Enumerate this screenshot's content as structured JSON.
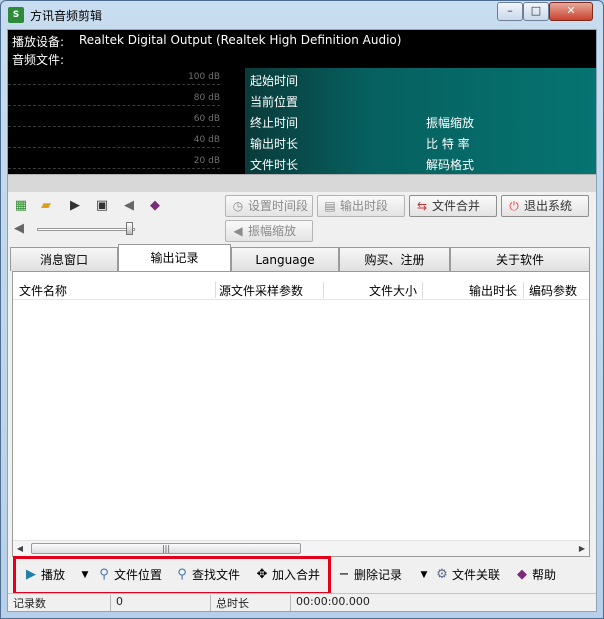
{
  "window": {
    "title": "方讯音频剪辑",
    "minimize": "–",
    "maximize": "□",
    "close": "✕"
  },
  "info": {
    "device_label": "播放设备:",
    "device_value": "Realtek Digital Output (Realtek High Definition Audio)",
    "file_label": "音频文件:"
  },
  "meter": {
    "levels": [
      "100 dB",
      "80 dB",
      "60 dB",
      "40 dB",
      "20 dB"
    ]
  },
  "time_labels": {
    "start": "起始时间",
    "current": "当前位置",
    "end": "终止时间",
    "output_duration": "输出时长",
    "file_duration": "文件时长",
    "amplitude": "振幅缩放",
    "bitrate": "比 特 率",
    "format": "解码格式"
  },
  "toolbar": {
    "set_period": "设置时间段",
    "output_period": "输出时段",
    "merge_files": "文件合并",
    "exit": "退出系统",
    "amplitude_zoom": "振幅缩放"
  },
  "volume": {
    "level": 0.95
  },
  "tabs": [
    "消息窗口",
    "输出记录",
    "Language",
    "购买、注册",
    "关于软件"
  ],
  "active_tab": 1,
  "list": {
    "columns": [
      "文件名称",
      "源文件采样参数",
      "文件大小",
      "输出时长",
      "编码参数"
    ],
    "rows": []
  },
  "actions": {
    "play": "播放",
    "file_location": "文件位置",
    "find_file": "查找文件",
    "add_merge": "加入合并",
    "delete_record": "删除记录",
    "file_assoc": "文件关联",
    "help": "帮助"
  },
  "status": {
    "record_count_label": "记录数",
    "record_count_value": "0",
    "total_duration_label": "总时长",
    "total_duration_value": "00:00:00.000"
  }
}
